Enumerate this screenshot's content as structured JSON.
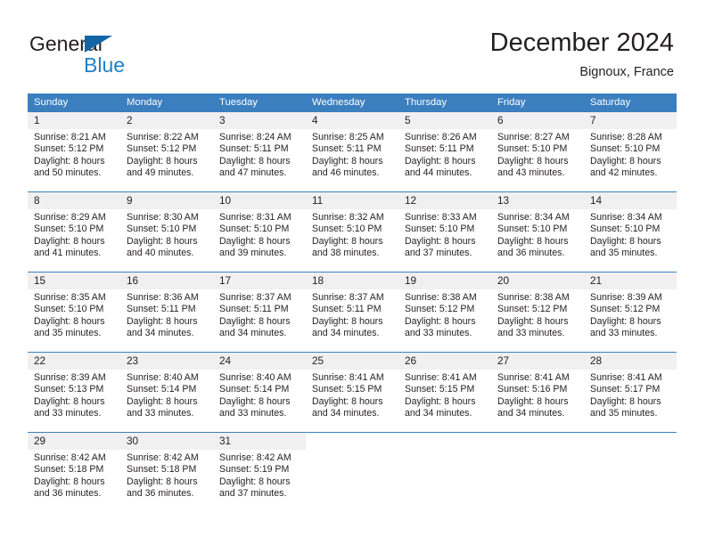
{
  "brand": {
    "name_part1": "General",
    "name_part2": "Blue",
    "logo_icon": "blue-triangle-icon",
    "accent_color": "#2180c9",
    "triangle_color": "#1565a4"
  },
  "header": {
    "title": "December 2024",
    "subtitle": "Bignoux, France"
  },
  "theme": {
    "header_row_bg": "#3c7fbf",
    "daynum_bg": "#f0f0f0",
    "grid_line": "#3c7fbf",
    "text": "#231f20"
  },
  "weekdays": [
    "Sunday",
    "Monday",
    "Tuesday",
    "Wednesday",
    "Thursday",
    "Friday",
    "Saturday"
  ],
  "weeks": [
    [
      {
        "day": "1",
        "sunrise": "Sunrise: 8:21 AM",
        "sunset": "Sunset: 5:12 PM",
        "daylight1": "Daylight: 8 hours",
        "daylight2": "and 50 minutes."
      },
      {
        "day": "2",
        "sunrise": "Sunrise: 8:22 AM",
        "sunset": "Sunset: 5:12 PM",
        "daylight1": "Daylight: 8 hours",
        "daylight2": "and 49 minutes."
      },
      {
        "day": "3",
        "sunrise": "Sunrise: 8:24 AM",
        "sunset": "Sunset: 5:11 PM",
        "daylight1": "Daylight: 8 hours",
        "daylight2": "and 47 minutes."
      },
      {
        "day": "4",
        "sunrise": "Sunrise: 8:25 AM",
        "sunset": "Sunset: 5:11 PM",
        "daylight1": "Daylight: 8 hours",
        "daylight2": "and 46 minutes."
      },
      {
        "day": "5",
        "sunrise": "Sunrise: 8:26 AM",
        "sunset": "Sunset: 5:11 PM",
        "daylight1": "Daylight: 8 hours",
        "daylight2": "and 44 minutes."
      },
      {
        "day": "6",
        "sunrise": "Sunrise: 8:27 AM",
        "sunset": "Sunset: 5:10 PM",
        "daylight1": "Daylight: 8 hours",
        "daylight2": "and 43 minutes."
      },
      {
        "day": "7",
        "sunrise": "Sunrise: 8:28 AM",
        "sunset": "Sunset: 5:10 PM",
        "daylight1": "Daylight: 8 hours",
        "daylight2": "and 42 minutes."
      }
    ],
    [
      {
        "day": "8",
        "sunrise": "Sunrise: 8:29 AM",
        "sunset": "Sunset: 5:10 PM",
        "daylight1": "Daylight: 8 hours",
        "daylight2": "and 41 minutes."
      },
      {
        "day": "9",
        "sunrise": "Sunrise: 8:30 AM",
        "sunset": "Sunset: 5:10 PM",
        "daylight1": "Daylight: 8 hours",
        "daylight2": "and 40 minutes."
      },
      {
        "day": "10",
        "sunrise": "Sunrise: 8:31 AM",
        "sunset": "Sunset: 5:10 PM",
        "daylight1": "Daylight: 8 hours",
        "daylight2": "and 39 minutes."
      },
      {
        "day": "11",
        "sunrise": "Sunrise: 8:32 AM",
        "sunset": "Sunset: 5:10 PM",
        "daylight1": "Daylight: 8 hours",
        "daylight2": "and 38 minutes."
      },
      {
        "day": "12",
        "sunrise": "Sunrise: 8:33 AM",
        "sunset": "Sunset: 5:10 PM",
        "daylight1": "Daylight: 8 hours",
        "daylight2": "and 37 minutes."
      },
      {
        "day": "13",
        "sunrise": "Sunrise: 8:34 AM",
        "sunset": "Sunset: 5:10 PM",
        "daylight1": "Daylight: 8 hours",
        "daylight2": "and 36 minutes."
      },
      {
        "day": "14",
        "sunrise": "Sunrise: 8:34 AM",
        "sunset": "Sunset: 5:10 PM",
        "daylight1": "Daylight: 8 hours",
        "daylight2": "and 35 minutes."
      }
    ],
    [
      {
        "day": "15",
        "sunrise": "Sunrise: 8:35 AM",
        "sunset": "Sunset: 5:10 PM",
        "daylight1": "Daylight: 8 hours",
        "daylight2": "and 35 minutes."
      },
      {
        "day": "16",
        "sunrise": "Sunrise: 8:36 AM",
        "sunset": "Sunset: 5:11 PM",
        "daylight1": "Daylight: 8 hours",
        "daylight2": "and 34 minutes."
      },
      {
        "day": "17",
        "sunrise": "Sunrise: 8:37 AM",
        "sunset": "Sunset: 5:11 PM",
        "daylight1": "Daylight: 8 hours",
        "daylight2": "and 34 minutes."
      },
      {
        "day": "18",
        "sunrise": "Sunrise: 8:37 AM",
        "sunset": "Sunset: 5:11 PM",
        "daylight1": "Daylight: 8 hours",
        "daylight2": "and 34 minutes."
      },
      {
        "day": "19",
        "sunrise": "Sunrise: 8:38 AM",
        "sunset": "Sunset: 5:12 PM",
        "daylight1": "Daylight: 8 hours",
        "daylight2": "and 33 minutes."
      },
      {
        "day": "20",
        "sunrise": "Sunrise: 8:38 AM",
        "sunset": "Sunset: 5:12 PM",
        "daylight1": "Daylight: 8 hours",
        "daylight2": "and 33 minutes."
      },
      {
        "day": "21",
        "sunrise": "Sunrise: 8:39 AM",
        "sunset": "Sunset: 5:12 PM",
        "daylight1": "Daylight: 8 hours",
        "daylight2": "and 33 minutes."
      }
    ],
    [
      {
        "day": "22",
        "sunrise": "Sunrise: 8:39 AM",
        "sunset": "Sunset: 5:13 PM",
        "daylight1": "Daylight: 8 hours",
        "daylight2": "and 33 minutes."
      },
      {
        "day": "23",
        "sunrise": "Sunrise: 8:40 AM",
        "sunset": "Sunset: 5:14 PM",
        "daylight1": "Daylight: 8 hours",
        "daylight2": "and 33 minutes."
      },
      {
        "day": "24",
        "sunrise": "Sunrise: 8:40 AM",
        "sunset": "Sunset: 5:14 PM",
        "daylight1": "Daylight: 8 hours",
        "daylight2": "and 33 minutes."
      },
      {
        "day": "25",
        "sunrise": "Sunrise: 8:41 AM",
        "sunset": "Sunset: 5:15 PM",
        "daylight1": "Daylight: 8 hours",
        "daylight2": "and 34 minutes."
      },
      {
        "day": "26",
        "sunrise": "Sunrise: 8:41 AM",
        "sunset": "Sunset: 5:15 PM",
        "daylight1": "Daylight: 8 hours",
        "daylight2": "and 34 minutes."
      },
      {
        "day": "27",
        "sunrise": "Sunrise: 8:41 AM",
        "sunset": "Sunset: 5:16 PM",
        "daylight1": "Daylight: 8 hours",
        "daylight2": "and 34 minutes."
      },
      {
        "day": "28",
        "sunrise": "Sunrise: 8:41 AM",
        "sunset": "Sunset: 5:17 PM",
        "daylight1": "Daylight: 8 hours",
        "daylight2": "and 35 minutes."
      }
    ],
    [
      {
        "day": "29",
        "sunrise": "Sunrise: 8:42 AM",
        "sunset": "Sunset: 5:18 PM",
        "daylight1": "Daylight: 8 hours",
        "daylight2": "and 36 minutes."
      },
      {
        "day": "30",
        "sunrise": "Sunrise: 8:42 AM",
        "sunset": "Sunset: 5:18 PM",
        "daylight1": "Daylight: 8 hours",
        "daylight2": "and 36 minutes."
      },
      {
        "day": "31",
        "sunrise": "Sunrise: 8:42 AM",
        "sunset": "Sunset: 5:19 PM",
        "daylight1": "Daylight: 8 hours",
        "daylight2": "and 37 minutes."
      },
      {
        "day": "",
        "sunrise": "",
        "sunset": "",
        "daylight1": "",
        "daylight2": ""
      },
      {
        "day": "",
        "sunrise": "",
        "sunset": "",
        "daylight1": "",
        "daylight2": ""
      },
      {
        "day": "",
        "sunrise": "",
        "sunset": "",
        "daylight1": "",
        "daylight2": ""
      },
      {
        "day": "",
        "sunrise": "",
        "sunset": "",
        "daylight1": "",
        "daylight2": ""
      }
    ]
  ]
}
